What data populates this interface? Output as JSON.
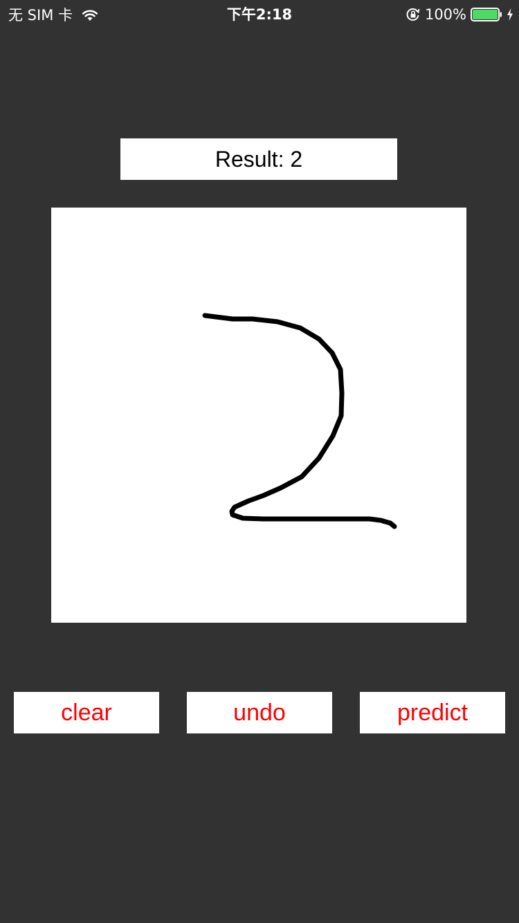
{
  "status_bar": {
    "carrier": "无 SIM 卡",
    "time": "下午2:18",
    "battery_percent": "100%",
    "icons": [
      "wifi-icon",
      "rotation-lock-icon",
      "battery-icon",
      "charging-bolt-icon"
    ],
    "battery_color": "#4cd964"
  },
  "result": {
    "text": "Result: 2"
  },
  "drawing": {
    "stroke_color": "#000000",
    "digit_drawn": "2"
  },
  "buttons": {
    "clear": "clear",
    "undo": "undo",
    "predict": "predict"
  },
  "colors": {
    "background": "#323232",
    "panel": "#ffffff",
    "button_text": "#ff0000"
  }
}
